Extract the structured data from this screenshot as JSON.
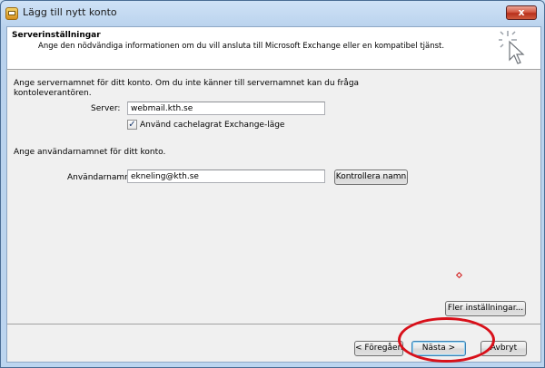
{
  "window": {
    "title": "Lägg till nytt konto",
    "close_glyph": "x"
  },
  "header": {
    "title": "Serverinställningar",
    "subtitle": "Ange den nödvändiga informationen om du vill ansluta till Microsoft Exchange eller en kompatibel tjänst.",
    "icon": "cursor-sparkle-icon"
  },
  "server_section": {
    "instruction": "Ange servernamnet för ditt konto. Om du inte känner till servernamnet kan du fråga kontoleverantören.",
    "label": "Server:",
    "value": "webmail.kth.se",
    "cache_checkbox": {
      "label": "Använd cachelagrat Exchange-läge",
      "checked": true,
      "check_glyph": "✓"
    }
  },
  "user_section": {
    "instruction": "Ange användarnamnet för ditt konto.",
    "label": "Användarnamn:",
    "value": "ekneling@kth.se",
    "check_name_button": "Kontrollera namn"
  },
  "more_settings_button": "Fler inställningar...",
  "footer": {
    "back_button": "< Föregående",
    "next_button": "Nästa >",
    "cancel_button": "Avbryt"
  },
  "colors": {
    "annotation": "#d8101a",
    "close_button": "#c8442e",
    "window_frame": "#b9d2ed"
  }
}
